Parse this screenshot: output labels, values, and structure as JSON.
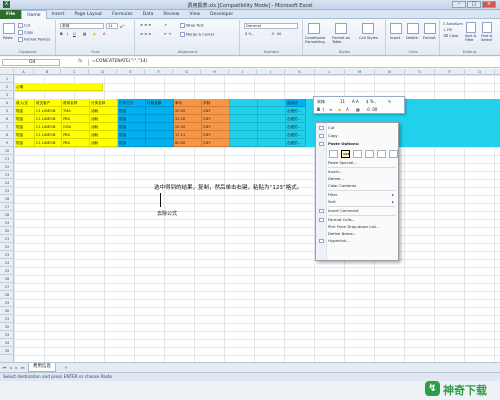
{
  "window": {
    "title": "费用报表.xls [Compatibility Mode] - Microsoft Excel"
  },
  "tabs": [
    "File",
    "Home",
    "Insert",
    "Page Layout",
    "Formulas",
    "Data",
    "Review",
    "View",
    "Developer"
  ],
  "ribbon": {
    "clipboard": {
      "paste": "Paste",
      "cut": "Cut",
      "copy": "Copy",
      "format_painter": "Format Painter",
      "group": "Clipboard"
    },
    "font": {
      "name": "宋体",
      "size": "11",
      "group": "Font"
    },
    "alignment": {
      "wrap": "Wrap Text",
      "merge": "Merge & Center",
      "group": "Alignment"
    },
    "number": {
      "format": "General",
      "group": "Number"
    },
    "styles": {
      "conditional": "Conditional Formatting",
      "format_table": "Format as Table",
      "cell_styles": "Cell Styles",
      "group": "Styles"
    },
    "cells": {
      "insert": "Insert",
      "delete": "Delete",
      "format": "Format",
      "group": "Cells"
    },
    "editing": {
      "autosum": "AutoSum",
      "fill": "Fill",
      "clear": "Clear",
      "sort": "Sort & Filter",
      "find": "Find & Select",
      "group": "Editing"
    }
  },
  "formula_bar": {
    "name_box": "O4",
    "fx": "fx",
    "formula": "=CONCATENATE(\"-\",\"14)"
  },
  "columns": [
    "A",
    "B",
    "C",
    "D",
    "E",
    "F",
    "G",
    "H",
    "I",
    "J",
    "K",
    "L",
    "M",
    "N",
    "O",
    "P",
    "Q"
  ],
  "rows": [
    "1",
    "2",
    "3",
    "4",
    "5",
    "6",
    "7",
    "8",
    "9",
    "10",
    "11",
    "12",
    "13",
    "14",
    "15",
    "16",
    "17",
    "18",
    "19",
    "20",
    "21",
    "22",
    "23",
    "24",
    "25",
    "26",
    "27",
    "28",
    "29",
    "30",
    "31",
    "32",
    "33",
    "34",
    "35"
  ],
  "sheet": {
    "title": "心情",
    "headers": [
      "收入/支",
      "收支客户",
      "费用名称",
      "分类名称",
      "付款方式",
      "付款金额",
      "单价",
      "币制",
      "",
      "",
      "费用项"
    ],
    "data_rows": [
      [
        "现金",
        "C1 LINEON",
        "TMA",
        "油耗",
        "现金",
        "",
        "50.00",
        "CNY",
        "",
        "",
        "出差的..."
      ],
      [
        "现金",
        "C1 LINEON",
        "PBS",
        "油耗",
        "现金",
        "",
        "31.20",
        "CNY",
        "",
        "",
        "出差的..."
      ],
      [
        "现金",
        "C1 LINEON",
        "CMA",
        "油耗",
        "现金",
        "",
        "50.00",
        "CNY",
        "",
        "",
        "出差的..."
      ],
      [
        "现金",
        "C1 LINEON",
        "PBS",
        "油耗",
        "现金",
        "",
        "17.11",
        "CNY",
        "",
        "",
        "出差的..."
      ],
      [
        "现金",
        "C1 LINEON",
        "PBS",
        "油耗",
        "现金",
        "",
        "80.00",
        "CNY",
        "",
        "",
        "出差的..."
      ]
    ]
  },
  "annotations": {
    "instruction": "选中得到的结果，复制，然后单击右键，粘贴为“123”格式。",
    "remove_formula": "去除公式"
  },
  "mini_toolbar": {
    "font": "宋体",
    "size": "11"
  },
  "context_menu": {
    "items": [
      "Cut",
      "Copy",
      "Paste Options:",
      "Paste Special...",
      "Insert...",
      "Delete...",
      "Clear Contents",
      "Filter",
      "Sort",
      "Insert Comment",
      "Format Cells...",
      "Pick From Drop-down List...",
      "Define Name...",
      "Hyperlink..."
    ]
  },
  "sheet_tab": "费用信息",
  "status": "Select destination and press ENTER or choose Paste",
  "watermark": "神奇下载",
  "colors": {
    "file_tab": "#2c6e2f",
    "yellow": "#ffff00",
    "blue": "#00b0f0",
    "orange": "#f79646",
    "teal": "#21d0ea"
  }
}
